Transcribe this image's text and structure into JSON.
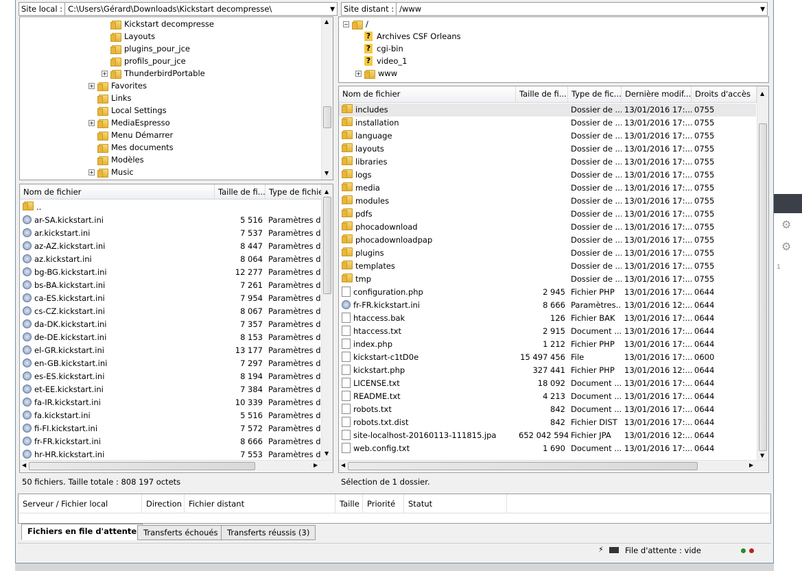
{
  "local": {
    "site_label": "Site local :",
    "path": "C:\\Users\\Gérard\\Downloads\\Kickstart decompresse\\",
    "tree": [
      {
        "label": "Kickstart decompresse",
        "level": 4,
        "expand": ""
      },
      {
        "label": "Layouts",
        "level": 4,
        "expand": ""
      },
      {
        "label": "plugins_pour_jce",
        "level": 4,
        "expand": ""
      },
      {
        "label": "profils_pour_jce",
        "level": 4,
        "expand": ""
      },
      {
        "label": "ThunderbirdPortable",
        "level": 4,
        "expand": "+"
      },
      {
        "label": "Favorites",
        "level": 3,
        "expand": "+"
      },
      {
        "label": "Links",
        "level": 3,
        "expand": ""
      },
      {
        "label": "Local Settings",
        "level": 3,
        "expand": ""
      },
      {
        "label": "MediaEspresso",
        "level": 3,
        "expand": "+"
      },
      {
        "label": "Menu Démarrer",
        "level": 3,
        "expand": ""
      },
      {
        "label": "Mes documents",
        "level": 3,
        "expand": ""
      },
      {
        "label": "Modèles",
        "level": 3,
        "expand": ""
      },
      {
        "label": "Music",
        "level": 3,
        "expand": "+"
      }
    ],
    "columns": [
      "Nom de fichier",
      "Taille de fi...",
      "Type de fichier"
    ],
    "files": [
      {
        "name": "..",
        "size": "",
        "type": "",
        "kind": "folder"
      },
      {
        "name": "ar-SA.kickstart.ini",
        "size": "5 516",
        "type": "Paramètres de",
        "kind": "ini"
      },
      {
        "name": "ar.kickstart.ini",
        "size": "7 537",
        "type": "Paramètres de",
        "kind": "ini"
      },
      {
        "name": "az-AZ.kickstart.ini",
        "size": "8 447",
        "type": "Paramètres de",
        "kind": "ini"
      },
      {
        "name": "az.kickstart.ini",
        "size": "8 064",
        "type": "Paramètres de",
        "kind": "ini"
      },
      {
        "name": "bg-BG.kickstart.ini",
        "size": "12 277",
        "type": "Paramètres de",
        "kind": "ini"
      },
      {
        "name": "bs-BA.kickstart.ini",
        "size": "7 261",
        "type": "Paramètres de",
        "kind": "ini"
      },
      {
        "name": "ca-ES.kickstart.ini",
        "size": "7 954",
        "type": "Paramètres de",
        "kind": "ini"
      },
      {
        "name": "cs-CZ.kickstart.ini",
        "size": "8 067",
        "type": "Paramètres de",
        "kind": "ini"
      },
      {
        "name": "da-DK.kickstart.ini",
        "size": "7 357",
        "type": "Paramètres de",
        "kind": "ini"
      },
      {
        "name": "de-DE.kickstart.ini",
        "size": "8 153",
        "type": "Paramètres de",
        "kind": "ini"
      },
      {
        "name": "el-GR.kickstart.ini",
        "size": "13 177",
        "type": "Paramètres de",
        "kind": "ini"
      },
      {
        "name": "en-GB.kickstart.ini",
        "size": "7 297",
        "type": "Paramètres de",
        "kind": "ini"
      },
      {
        "name": "es-ES.kickstart.ini",
        "size": "8 194",
        "type": "Paramètres de",
        "kind": "ini"
      },
      {
        "name": "et-EE.kickstart.ini",
        "size": "7 384",
        "type": "Paramètres de",
        "kind": "ini"
      },
      {
        "name": "fa-IR.kickstart.ini",
        "size": "10 339",
        "type": "Paramètres de",
        "kind": "ini"
      },
      {
        "name": "fa.kickstart.ini",
        "size": "5 516",
        "type": "Paramètres de",
        "kind": "ini"
      },
      {
        "name": "fi-FI.kickstart.ini",
        "size": "7 572",
        "type": "Paramètres de",
        "kind": "ini"
      },
      {
        "name": "fr-FR.kickstart.ini",
        "size": "8 666",
        "type": "Paramètres de",
        "kind": "ini"
      },
      {
        "name": "hr-HR.kickstart.ini",
        "size": "7 553",
        "type": "Paramètres de",
        "kind": "ini"
      }
    ],
    "status": "50 fichiers. Taille totale : 808 197 octets"
  },
  "remote": {
    "site_label": "Site distant :",
    "path": "/www",
    "tree": [
      {
        "label": "/",
        "level": 0,
        "expand": "−",
        "icon": "folder"
      },
      {
        "label": "Archives CSF Orleans",
        "level": 1,
        "expand": "",
        "icon": "question"
      },
      {
        "label": "cgi-bin",
        "level": 1,
        "expand": "",
        "icon": "question"
      },
      {
        "label": "video_1",
        "level": 1,
        "expand": "",
        "icon": "question"
      },
      {
        "label": "www",
        "level": 1,
        "expand": "+",
        "icon": "folder"
      }
    ],
    "columns": [
      "Nom de fichier",
      "Taille de fi...",
      "Type de fic...",
      "Dernière modif...",
      "Droits d'accès"
    ],
    "files": [
      {
        "name": "includes",
        "size": "",
        "type": "Dossier de ...",
        "date": "13/01/2016 17:...",
        "perm": "0755",
        "kind": "folder"
      },
      {
        "name": "installation",
        "size": "",
        "type": "Dossier de ...",
        "date": "13/01/2016 17:...",
        "perm": "0755",
        "kind": "folder"
      },
      {
        "name": "language",
        "size": "",
        "type": "Dossier de ...",
        "date": "13/01/2016 17:...",
        "perm": "0755",
        "kind": "folder"
      },
      {
        "name": "layouts",
        "size": "",
        "type": "Dossier de ...",
        "date": "13/01/2016 17:...",
        "perm": "0755",
        "kind": "folder"
      },
      {
        "name": "libraries",
        "size": "",
        "type": "Dossier de ...",
        "date": "13/01/2016 17:...",
        "perm": "0755",
        "kind": "folder"
      },
      {
        "name": "logs",
        "size": "",
        "type": "Dossier de ...",
        "date": "13/01/2016 17:...",
        "perm": "0755",
        "kind": "folder"
      },
      {
        "name": "media",
        "size": "",
        "type": "Dossier de ...",
        "date": "13/01/2016 17:...",
        "perm": "0755",
        "kind": "folder"
      },
      {
        "name": "modules",
        "size": "",
        "type": "Dossier de ...",
        "date": "13/01/2016 17:...",
        "perm": "0755",
        "kind": "folder"
      },
      {
        "name": "pdfs",
        "size": "",
        "type": "Dossier de ...",
        "date": "13/01/2016 17:...",
        "perm": "0755",
        "kind": "folder"
      },
      {
        "name": "phocadownload",
        "size": "",
        "type": "Dossier de ...",
        "date": "13/01/2016 17:...",
        "perm": "0755",
        "kind": "folder"
      },
      {
        "name": "phocadownloadpap",
        "size": "",
        "type": "Dossier de ...",
        "date": "13/01/2016 17:...",
        "perm": "0755",
        "kind": "folder"
      },
      {
        "name": "plugins",
        "size": "",
        "type": "Dossier de ...",
        "date": "13/01/2016 17:...",
        "perm": "0755",
        "kind": "folder"
      },
      {
        "name": "templates",
        "size": "",
        "type": "Dossier de ...",
        "date": "13/01/2016 17:...",
        "perm": "0755",
        "kind": "folder"
      },
      {
        "name": "tmp",
        "size": "",
        "type": "Dossier de ...",
        "date": "13/01/2016 17:...",
        "perm": "0755",
        "kind": "folder"
      },
      {
        "name": "configuration.php",
        "size": "2 945",
        "type": "Fichier PHP",
        "date": "13/01/2016 17:...",
        "perm": "0644",
        "kind": "file"
      },
      {
        "name": "fr-FR.kickstart.ini",
        "size": "8 666",
        "type": "Paramètres...",
        "date": "13/01/2016 12:...",
        "perm": "0644",
        "kind": "ini"
      },
      {
        "name": "htaccess.bak",
        "size": "126",
        "type": "Fichier BAK",
        "date": "13/01/2016 17:...",
        "perm": "0644",
        "kind": "file"
      },
      {
        "name": "htaccess.txt",
        "size": "2 915",
        "type": "Document ...",
        "date": "13/01/2016 17:...",
        "perm": "0644",
        "kind": "file"
      },
      {
        "name": "index.php",
        "size": "1 212",
        "type": "Fichier PHP",
        "date": "13/01/2016 17:...",
        "perm": "0644",
        "kind": "file"
      },
      {
        "name": "kickstart-c1tD0e",
        "size": "15 497 456",
        "type": "File",
        "date": "13/01/2016 17:...",
        "perm": "0600",
        "kind": "file"
      },
      {
        "name": "kickstart.php",
        "size": "327 441",
        "type": "Fichier PHP",
        "date": "13/01/2016 12:...",
        "perm": "0644",
        "kind": "file"
      },
      {
        "name": "LICENSE.txt",
        "size": "18 092",
        "type": "Document ...",
        "date": "13/01/2016 17:...",
        "perm": "0644",
        "kind": "file"
      },
      {
        "name": "README.txt",
        "size": "4 213",
        "type": "Document ...",
        "date": "13/01/2016 17:...",
        "perm": "0644",
        "kind": "file"
      },
      {
        "name": "robots.txt",
        "size": "842",
        "type": "Document ...",
        "date": "13/01/2016 17:...",
        "perm": "0644",
        "kind": "file"
      },
      {
        "name": "robots.txt.dist",
        "size": "842",
        "type": "Fichier DIST",
        "date": "13/01/2016 17:...",
        "perm": "0644",
        "kind": "file"
      },
      {
        "name": "site-localhost-20160113-111815.jpa",
        "size": "652 042 594",
        "type": "Fichier JPA",
        "date": "13/01/2016 12:...",
        "perm": "0644",
        "kind": "file"
      },
      {
        "name": "web.config.txt",
        "size": "1 690",
        "type": "Document ...",
        "date": "13/01/2016 17:...",
        "perm": "0644",
        "kind": "file"
      }
    ],
    "status": "Sélection de 1 dossier."
  },
  "queue": {
    "columns": [
      "Serveur / Fichier local",
      "Direction",
      "Fichier distant",
      "Taille",
      "Priorité",
      "Statut"
    ],
    "tabs": [
      "Fichiers en file d'attente",
      "Transferts échoués",
      "Transferts réussis (3)"
    ],
    "status": "File d'attente : vide"
  },
  "background": {
    "page_label": "1"
  }
}
